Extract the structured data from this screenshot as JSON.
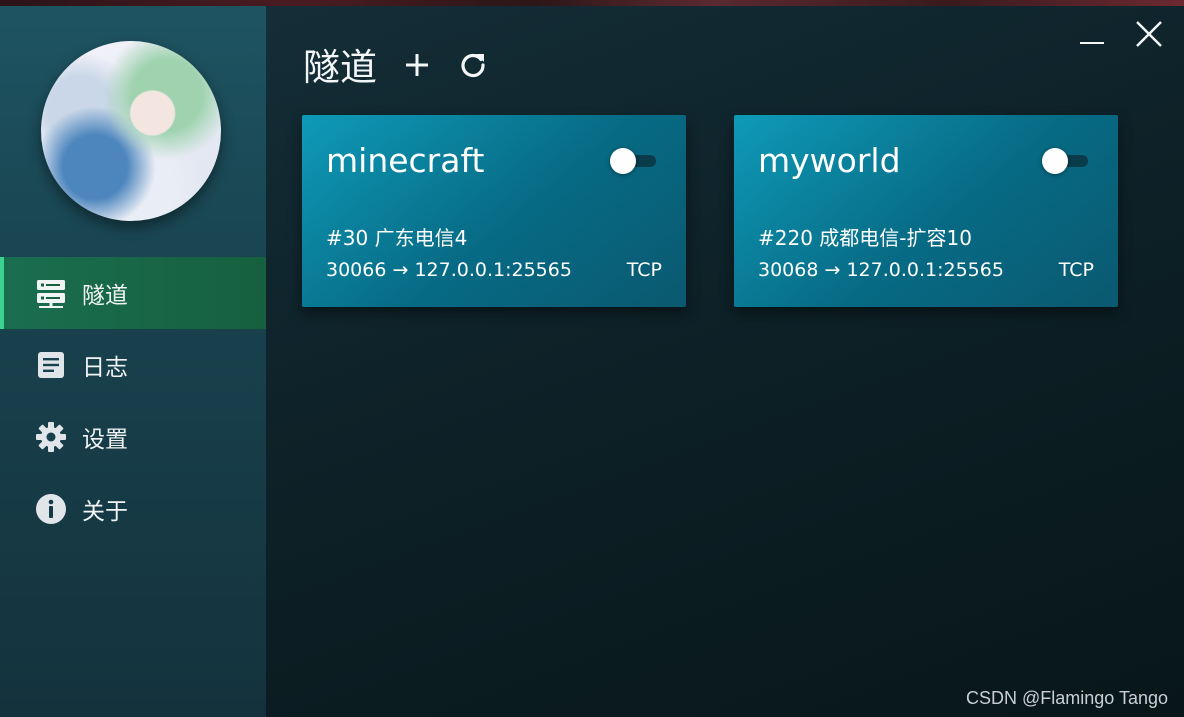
{
  "background": {
    "text": ""
  },
  "app": {
    "title": "隧道",
    "add_icon": "plus-icon",
    "refresh_icon": "refresh-icon",
    "minimize_icon": "minimize-icon",
    "close_icon": "close-icon"
  },
  "sidebar": {
    "avatar": "user-avatar",
    "items": [
      {
        "label": "隧道",
        "icon": "server-icon",
        "active": true
      },
      {
        "label": "日志",
        "icon": "document-icon",
        "active": false
      },
      {
        "label": "设置",
        "icon": "gear-icon",
        "active": false
      },
      {
        "label": "关于",
        "icon": "info-icon",
        "active": false
      }
    ]
  },
  "tunnels": [
    {
      "name": "minecraft",
      "node": "#30 广东电信4",
      "mapping": "30066 → 127.0.0.1:25565",
      "protocol": "TCP",
      "enabled": false
    },
    {
      "name": "myworld",
      "node": "#220 成都电信-扩容10",
      "mapping": "30068 → 127.0.0.1:25565",
      "protocol": "TCP",
      "enabled": false
    }
  ],
  "colors": {
    "accent": "#3bd48e",
    "card": "#0a7f9c",
    "sidebar": "#1e5462",
    "active_nav": "#16603f"
  },
  "watermark": "CSDN @Flamingo Tango"
}
